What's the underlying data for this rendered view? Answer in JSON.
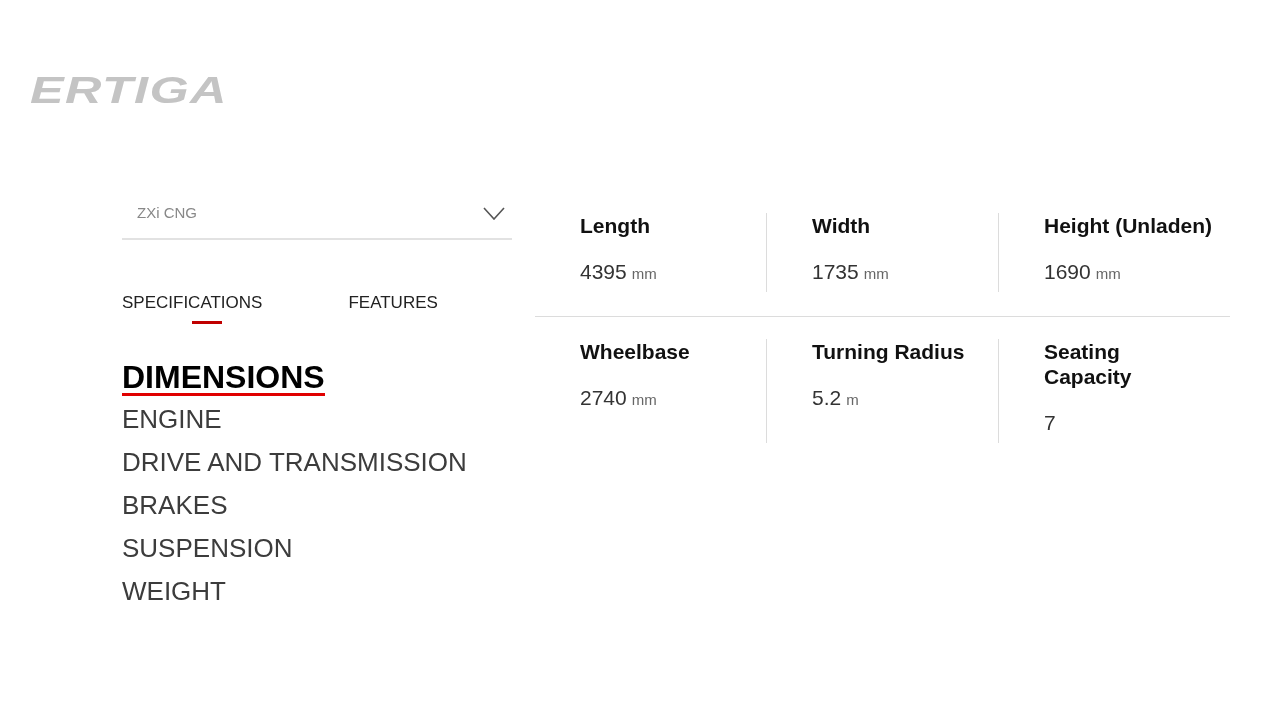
{
  "logo": "ERTIGA",
  "variant_dropdown": {
    "value": "ZXi CNG"
  },
  "tabs": [
    {
      "label": "SPECIFICATIONS",
      "selected": true
    },
    {
      "label": "FEATURES",
      "selected": false
    }
  ],
  "categories": [
    {
      "label": "DIMENSIONS",
      "selected": true
    },
    {
      "label": "ENGINE",
      "selected": false
    },
    {
      "label": "DRIVE AND TRANSMISSION",
      "selected": false
    },
    {
      "label": "BRAKES",
      "selected": false
    },
    {
      "label": "SUSPENSION",
      "selected": false
    },
    {
      "label": "WEIGHT",
      "selected": false
    }
  ],
  "spec_rows": [
    {
      "cells": [
        {
          "label": "Length",
          "value": "4395",
          "unit": "mm"
        },
        {
          "label": "Width",
          "value": "1735",
          "unit": "mm"
        },
        {
          "label": "Height (Unladen)",
          "value": "1690",
          "unit": "mm"
        }
      ]
    },
    {
      "cells": [
        {
          "label": "Wheelbase",
          "value": "2740",
          "unit": "mm"
        },
        {
          "label": "Turning Radius",
          "value": "5.2",
          "unit": "m"
        },
        {
          "label": "Seating\nCapacity",
          "value": "7"
        }
      ]
    }
  ]
}
